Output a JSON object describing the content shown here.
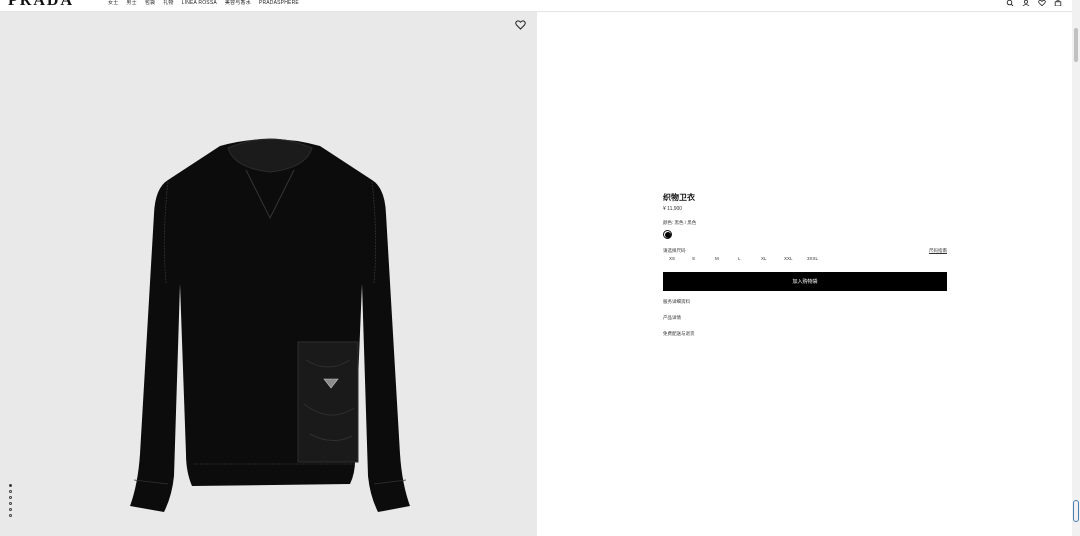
{
  "header": {
    "logo": "PRADA",
    "nav": [
      "女士",
      "男士",
      "包袋",
      "礼物",
      "LINEA ROSSA",
      "美容与香水",
      "PRADASPHERE"
    ],
    "icons": [
      "search-icon",
      "account-icon",
      "wishlist-icon",
      "bag-icon"
    ]
  },
  "media": {
    "image_alt": "sweatshirt",
    "carousel_count": 6,
    "carousel_active": 0
  },
  "product": {
    "name": "织物卫衣",
    "price": "¥ 11,900",
    "color_label": "颜色: 黑色 / 黑色",
    "color_hex": "#000000",
    "size_label": "请选择尺码",
    "size_guide": "尺码指南",
    "sizes": [
      "XS",
      "S",
      "M",
      "L",
      "XL",
      "XXL",
      "3XXL"
    ],
    "add_to_bag": "加入购物袋",
    "links": [
      "服务详细资料",
      "产品详情",
      "免费配送与退货"
    ]
  }
}
